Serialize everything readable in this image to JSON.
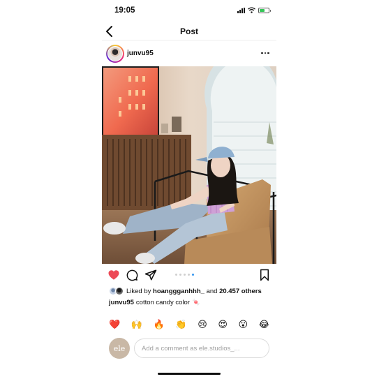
{
  "status_bar": {
    "time": "19:05",
    "battery_level": 0.6,
    "battery_color": "#35c759",
    "icons": [
      "signal-icon",
      "wifi-icon",
      "battery-icon"
    ]
  },
  "nav": {
    "title": "Post",
    "back_icon": "chevron-left-icon"
  },
  "post": {
    "username": "junvu95",
    "more_icon": "more-horizontal-icon",
    "image_alt": "photo",
    "carousel": {
      "count": 5,
      "active_index": 4
    },
    "actions": {
      "liked": true,
      "like_color": "#ed4956",
      "icons": [
        "heart-icon",
        "comment-icon",
        "share-icon",
        "bookmark-icon"
      ]
    },
    "likes": {
      "prefix": "Liked by",
      "user": "hoanggganhhh_",
      "and": "and",
      "others": "20.457 others"
    },
    "caption": {
      "user": "junvu95",
      "text": "cotton candy color",
      "emoji": "🍬"
    }
  },
  "reactions": [
    "❤️",
    "🙌",
    "🔥",
    "👏",
    "😢",
    "😍",
    "😮",
    "😂"
  ],
  "comment": {
    "avatar_text": "ele",
    "placeholder": "Add a comment as ele.studios_..."
  }
}
